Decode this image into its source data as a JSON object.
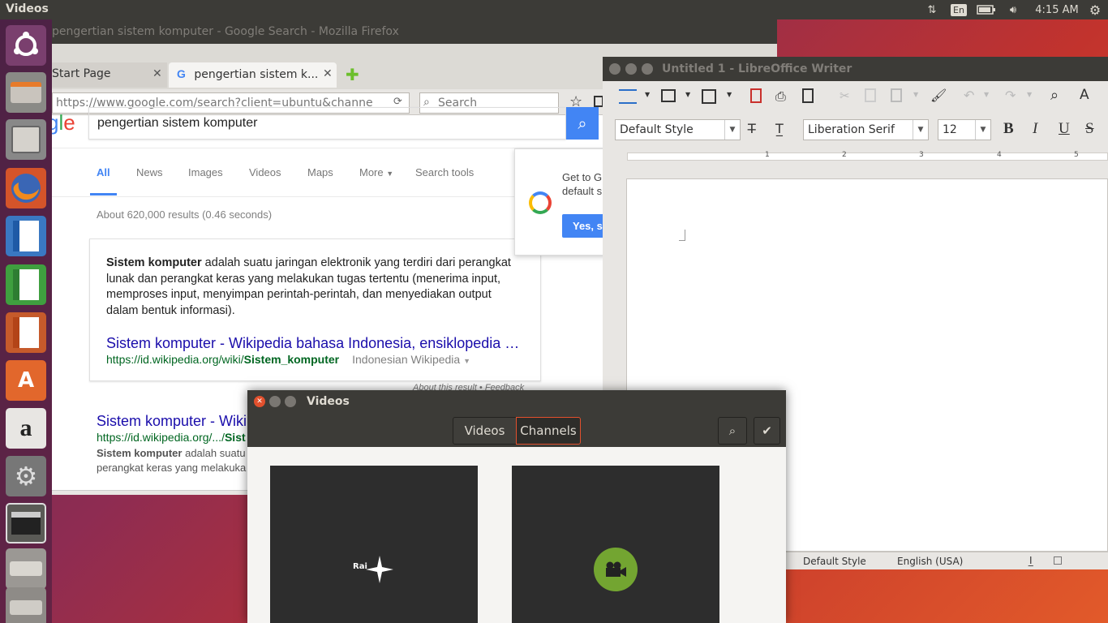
{
  "top_panel": {
    "app_name": "Videos",
    "keyboard_layout": "En",
    "clock": "4:15 AM"
  },
  "launcher": {
    "items": [
      "ubuntu-dash",
      "system-installer",
      "files",
      "firefox",
      "libreoffice-writer",
      "libreoffice-calc",
      "libreoffice-impress",
      "ubuntu-software",
      "amazon",
      "system-settings",
      "videos",
      "drive",
      "trash"
    ]
  },
  "firefox": {
    "title": "pengertian sistem komputer - Google Search - Mozilla Firefox",
    "tabs": [
      {
        "label": "Start Page"
      },
      {
        "label": "pengertian sistem k..."
      }
    ],
    "url": "https://www.google.com/search?client=ubuntu&channe",
    "search_placeholder": "Search",
    "google": {
      "logo_fragment": "gle",
      "query": "pengertian sistem komputer",
      "tabs": [
        "All",
        "News",
        "Images",
        "Videos",
        "Maps",
        "More",
        "Search tools"
      ],
      "result_stats": "About 620,000 results (0.46 seconds)",
      "snippet_bold": "Sistem komputer",
      "snippet_text": " adalah suatu jaringan elektronik yang terdiri dari perangkat lunak dan perangkat keras yang melakukan tugas tertentu (menerima input, memproses input, menyimpan perintah-perintah, dan menyediakan output dalam bentuk informasi).",
      "snippet_link": "Sistem komputer - Wikipedia bahasa Indonesia, ensiklopedia …",
      "snippet_url_prefix": "https://id.wikipedia.org/wiki/",
      "snippet_url_bold": "Sistem_komputer",
      "snippet_source": "Indonesian Wikipedia",
      "about_feedback": "About this result • Feedback",
      "result2_title": "Sistem komputer - Wiki",
      "result2_url_prefix": "https://id.wikipedia.org/.../",
      "result2_url_bold": "Sist",
      "result2_desc_bold": "Sistem komputer",
      "result2_desc": " adalah suatu",
      "result2_desc2": "perangkat keras yang melakuka",
      "popup_text1": "Get to G",
      "popup_text2": "default s",
      "popup_button": "Yes, s"
    }
  },
  "writer": {
    "title": "Untitled 1 - LibreOffice Writer",
    "paragraph_style": "Default Style",
    "font_name": "Liberation Serif",
    "font_size": "12",
    "ruler_numbers": [
      "1",
      "1",
      "2",
      "3",
      "4",
      "5"
    ],
    "status_style": "Default Style",
    "status_language": "English (USA)"
  },
  "videos": {
    "title": "Videos",
    "tabs": [
      "Videos",
      "Channels"
    ],
    "active_tab": "Channels",
    "channels": [
      {
        "logo_text": "Rai"
      },
      {
        "logo_text": ""
      }
    ]
  },
  "colors": {
    "panel": "#3c3b37",
    "google_blue": "#4285f4",
    "link_blue": "#1a0dab",
    "url_green": "#006621",
    "close_orange": "#e2502d",
    "channel_green": "#73a531"
  }
}
